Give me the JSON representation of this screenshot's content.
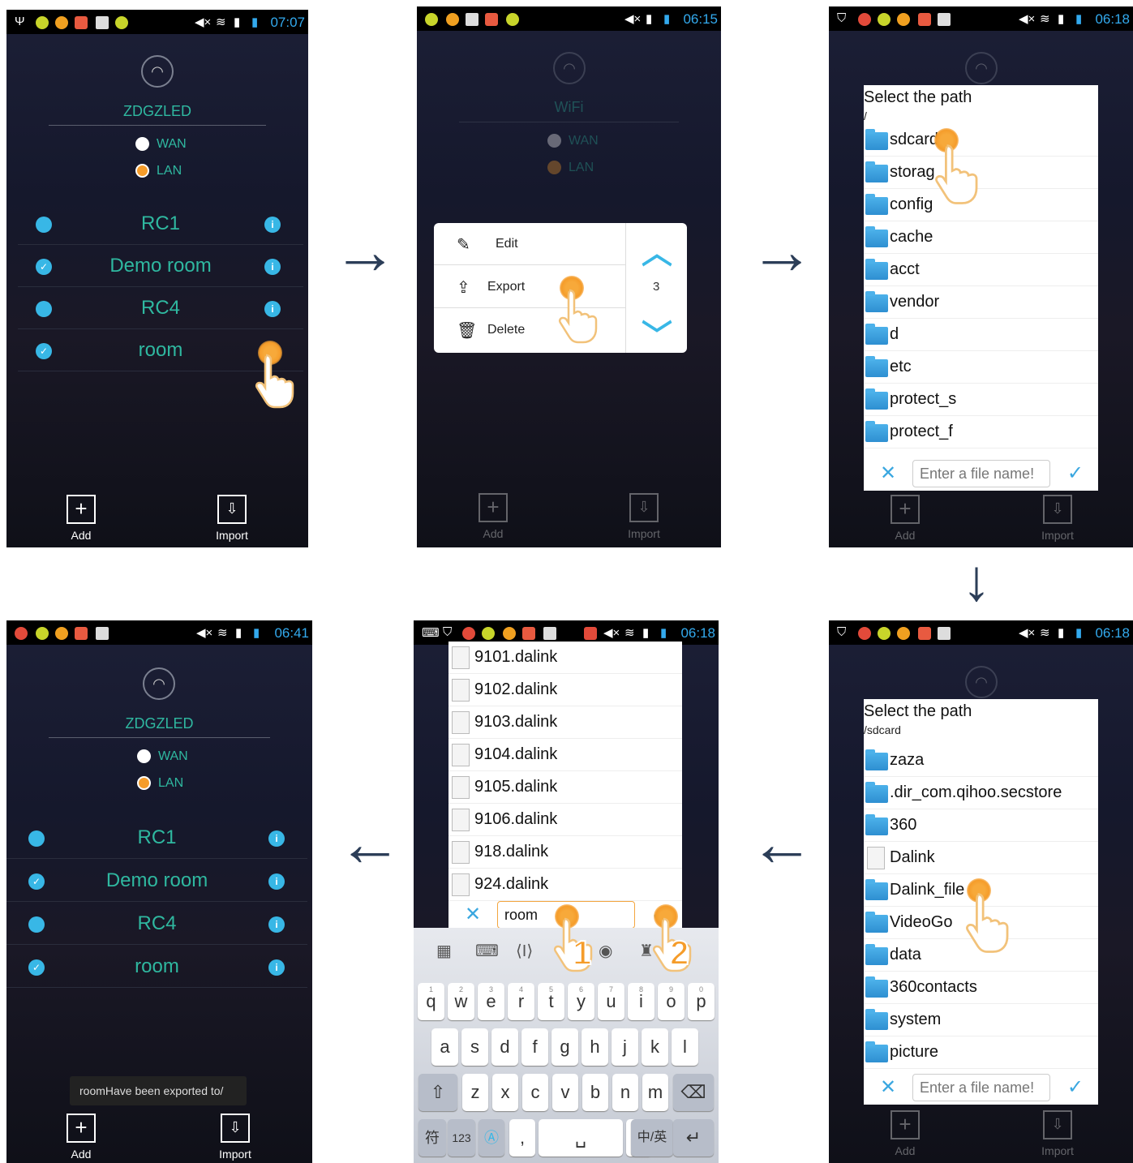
{
  "status_times": [
    "07:07",
    "06:15",
    "06:18",
    "06:41",
    "06:18",
    "06:18"
  ],
  "app": {
    "device_name": "ZDGZLED",
    "wifi_label": "WiFi",
    "wan": "WAN",
    "lan": "LAN",
    "rooms": [
      "RC1",
      "Demo room",
      "RC4",
      "room"
    ],
    "add": "Add",
    "import": "Import"
  },
  "menu": {
    "edit": "Edit",
    "export": "Export",
    "delete": "Delete",
    "count": "3"
  },
  "path_dialog": {
    "title": "Select the path",
    "root_path": "/",
    "root_items": [
      "sdcard",
      "storag",
      "config",
      "cache",
      "acct",
      "vendor",
      "d",
      "etc",
      "protect_s",
      "protect_f"
    ],
    "sdcard_path": "/sdcard",
    "sdcard_items": [
      "zaza",
      ".dir_com.qihoo.secstore",
      "360",
      "Dalink",
      "Dalink_file",
      "VideoGo",
      "data",
      "360contacts",
      "system",
      "picture"
    ],
    "placeholder": "Enter a file name!"
  },
  "files": {
    "items": [
      "9101.dalink",
      "9102.dalink",
      "9103.dalink",
      "9104.dalink",
      "9105.dalink",
      "9106.dalink",
      "918.dalink",
      "924.dalink"
    ],
    "filename": "room"
  },
  "keyboard": {
    "row1": [
      "q",
      "w",
      "e",
      "r",
      "t",
      "y",
      "u",
      "i",
      "o",
      "p"
    ],
    "row1_nums": [
      "1",
      "2",
      "3",
      "4",
      "5",
      "6",
      "7",
      "8",
      "9",
      "0"
    ],
    "row2": [
      "a",
      "s",
      "d",
      "f",
      "g",
      "h",
      "j",
      "k",
      "l"
    ],
    "row3": [
      "z",
      "x",
      "c",
      "v",
      "b",
      "n",
      "m"
    ],
    "sym": "符",
    "num": "123",
    "lang": "中/英",
    "comma": ",",
    "period": "."
  },
  "toast": {
    "name": "room",
    "message": "Have been exported to/"
  },
  "steps": [
    "1",
    "2"
  ]
}
